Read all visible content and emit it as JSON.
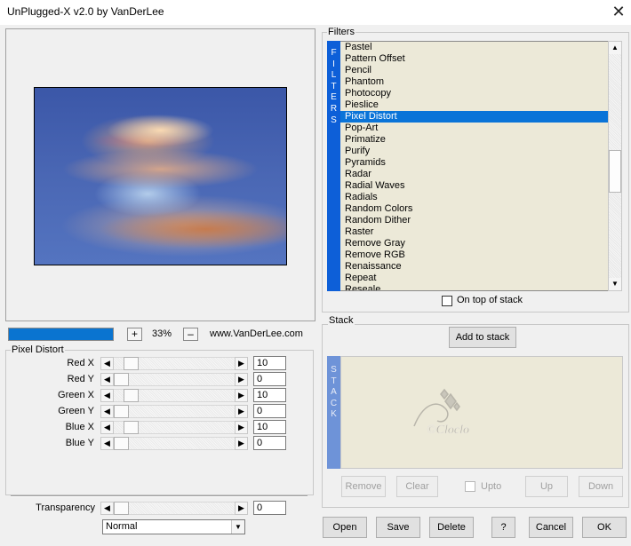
{
  "window": {
    "title": "UnPlugged-X v2.0 by VanDerLee",
    "close_icon": "close-icon"
  },
  "toolbar": {
    "zoom_in": "+",
    "zoom_value": "33%",
    "zoom_out": "–",
    "website": "www.VanDerLee.com"
  },
  "params": {
    "group_label": "Pixel Distort",
    "rows": [
      {
        "label": "Red X",
        "value": "10"
      },
      {
        "label": "Red Y",
        "value": "0"
      },
      {
        "label": "Green X",
        "value": "10"
      },
      {
        "label": "Green Y",
        "value": "0"
      },
      {
        "label": "Blue X",
        "value": "10"
      },
      {
        "label": "Blue Y",
        "value": "0"
      }
    ],
    "transparency_label": "Transparency",
    "transparency_value": "0",
    "blend_mode": "Normal"
  },
  "filters": {
    "group_label": "Filters",
    "vertical_label": [
      "F",
      "I",
      "L",
      "T",
      "E",
      "R",
      "S"
    ],
    "items": [
      "Pastel",
      "Pattern Offset",
      "Pencil",
      "Phantom",
      "Photocopy",
      "Pieslice",
      "Pixel Distort",
      "Pop-Art",
      "Primatize",
      "Purify",
      "Pyramids",
      "Radar",
      "Radial Waves",
      "Radials",
      "Random Colors",
      "Random Dither",
      "Raster",
      "Remove Gray",
      "Remove RGB",
      "Renaissance",
      "Repeat",
      "Reseale"
    ],
    "selected": "Pixel Distort",
    "on_top_label": "On top of stack"
  },
  "stack": {
    "group_label": "Stack",
    "add_label": "Add to stack",
    "vertical_label": [
      "S",
      "T",
      "A",
      "C",
      "K"
    ],
    "watermark_text": "©Cloclo",
    "remove_label": "Remove",
    "clear_label": "Clear",
    "upto_label": "Upto",
    "up_label": "Up",
    "down_label": "Down"
  },
  "footer": {
    "open": "Open",
    "save": "Save",
    "delete": "Delete",
    "help": "?",
    "cancel": "Cancel",
    "ok": "OK"
  },
  "colors": {
    "selection": "#0a74d8",
    "filters_bar": "#0d5fd8",
    "stack_bar": "#6e93d8",
    "list_bg": "#ece9d8"
  }
}
